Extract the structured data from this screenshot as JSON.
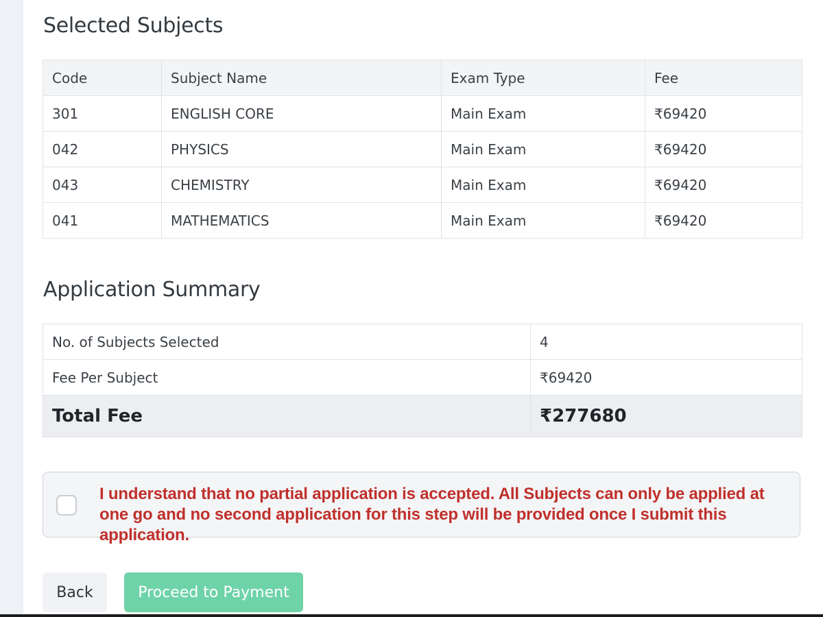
{
  "selected_subjects": {
    "title": "Selected Subjects",
    "headers": [
      "Code",
      "Subject Name",
      "Exam Type",
      "Fee"
    ],
    "rows": [
      [
        "301",
        "ENGLISH CORE",
        "Main Exam",
        "₹69420"
      ],
      [
        "042",
        "PHYSICS",
        "Main Exam",
        "₹69420"
      ],
      [
        "043",
        "CHEMISTRY",
        "Main Exam",
        "₹69420"
      ],
      [
        "041",
        "MATHEMATICS",
        "Main Exam",
        "₹69420"
      ]
    ]
  },
  "application_summary": {
    "title": "Application Summary",
    "rows": [
      {
        "label": "No. of Subjects Selected",
        "value": "4"
      },
      {
        "label": "Fee Per Subject",
        "value": "₹69420"
      },
      {
        "label": "Total Fee",
        "value": "₹277680"
      }
    ]
  },
  "agreement": {
    "checked": false,
    "text": "I understand that no partial application is accepted. All Subjects can only be applied at one go and no second application for this step will be provided once I submit this application."
  },
  "actions": {
    "back_label": "Back",
    "proceed_label": "Proceed to Payment"
  },
  "colors": {
    "agreement_text": "#c0302b",
    "proceed_button": "#6fd3a8",
    "back_button": "#f0f2f5"
  }
}
